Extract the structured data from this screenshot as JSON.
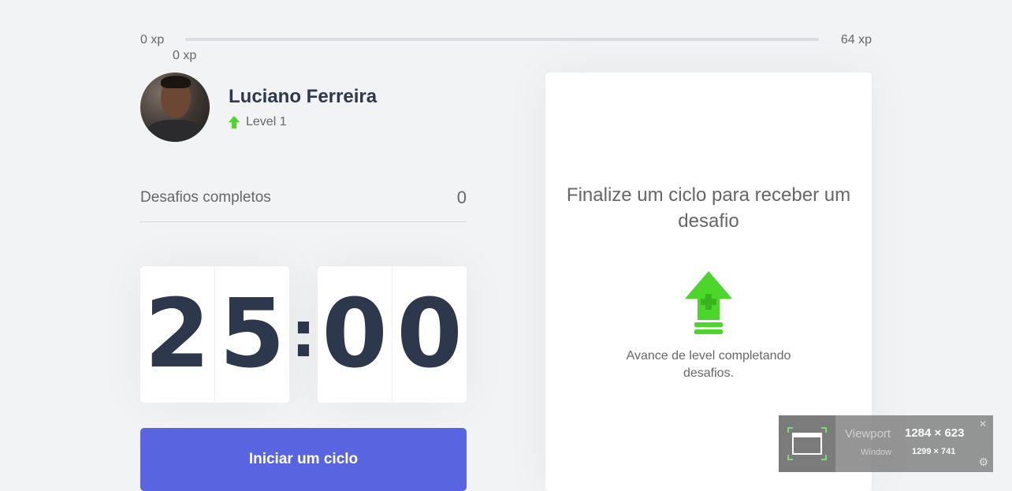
{
  "xp_bar": {
    "min_label": "0 xp",
    "max_label": "64 xp",
    "current_label": "0 xp",
    "progress_fraction": 0
  },
  "profile": {
    "name": "Luciano Ferreira",
    "level_label": "Level 1",
    "level_icon": "level-up-arrow-icon"
  },
  "challenges": {
    "label": "Desafios completos",
    "count": "0"
  },
  "countdown": {
    "minute_left": "2",
    "minute_right": "5",
    "separator": ":",
    "second_left": "0",
    "second_right": "0"
  },
  "start_button": {
    "label": "Iniciar um ciclo"
  },
  "challenge_box": {
    "title": "Finalize um ciclo para receber um desafio",
    "description": "Avance de level completando desafios."
  },
  "viewport_overlay": {
    "viewport_label": "Viewport",
    "viewport_value": "1284 × 623",
    "window_label": "Window",
    "window_value": "1299 × 741"
  },
  "colors": {
    "background": "#f2f3f5",
    "primary_blue": "#5965e0",
    "level_green": "#4cd62b",
    "title_text": "#2e384d",
    "body_text": "#666666"
  }
}
